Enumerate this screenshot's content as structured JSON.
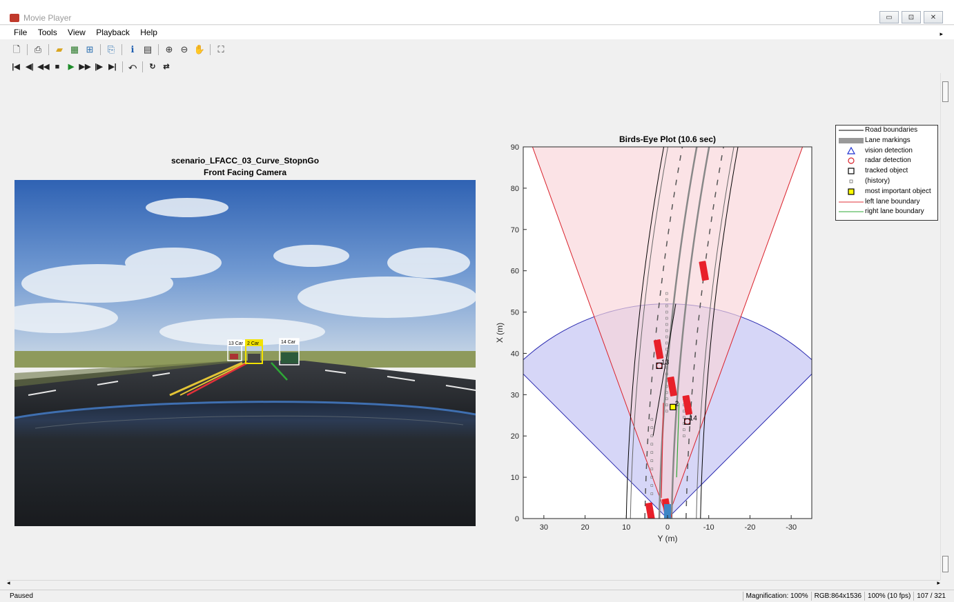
{
  "window": {
    "title": "Movie Player",
    "buttons": [
      "▭",
      "⊡",
      "✕"
    ]
  },
  "menu": [
    "File",
    "Tools",
    "View",
    "Playback",
    "Help"
  ],
  "toolbar": {
    "icons": [
      "new-icon",
      "print-icon",
      "open-icon",
      "open-workspace-icon",
      "simulink-icon",
      "export-icon",
      "info-icon",
      "colormap-icon",
      "zoom-in-icon",
      "zoom-out-icon",
      "pan-icon",
      "fit-window-icon"
    ],
    "playback": [
      "⏮",
      "◀|",
      "◀◀",
      "■",
      "▶",
      "▶▶",
      "|▶",
      "⏭"
    ]
  },
  "camera": {
    "title_line1": "scenario_LFACC_03_Curve_StopnGo",
    "title_line2": "Front Facing Camera",
    "boxes": [
      {
        "label": "13 Car",
        "highlight": false
      },
      {
        "label": "2 Car",
        "highlight": true
      },
      {
        "label": "14 Car",
        "highlight": false
      }
    ]
  },
  "bev": {
    "title": "Birds-Eye Plot (10.6 sec)",
    "xlabel": "Y (m)",
    "ylabel": "X (m)",
    "x_ticks": [
      "30",
      "20",
      "10",
      "0",
      "-10",
      "-20",
      "-30"
    ],
    "y_ticks": [
      "0",
      "10",
      "20",
      "30",
      "40",
      "50",
      "60",
      "70",
      "80",
      "90"
    ],
    "track_labels": [
      "13",
      "2",
      "14"
    ]
  },
  "chart_data": {
    "type": "scatter",
    "title": "Birds-Eye Plot (10.6 sec)",
    "xlabel": "Y (m)",
    "ylabel": "X (m)",
    "xlim": [
      35,
      -35
    ],
    "ylim": [
      0,
      90
    ],
    "tracked_objects": [
      {
        "id": "13",
        "y": 2,
        "x": 37
      },
      {
        "id": "2",
        "y": -1.3,
        "x": 27
      },
      {
        "id": "14",
        "y": -4.8,
        "x": 23.5
      }
    ],
    "vehicles": [
      {
        "y": -9,
        "x": 59
      },
      {
        "y": 2,
        "x": 40
      },
      {
        "y": -1.3,
        "x": 31
      },
      {
        "y": -5,
        "x": 26.5
      },
      {
        "y": 4,
        "x": 0.5
      },
      {
        "y": 0,
        "x": 1.5
      }
    ],
    "radar_coverage": {
      "range_m": 52,
      "fov_deg": 90
    },
    "vision_coverage": {
      "range_m": 90,
      "fov_deg": 40
    },
    "colors": {
      "radar_fill": "#ccccf5",
      "vision_fill": "#f9d4d8",
      "vehicle": "#e8202a",
      "ego": "#3d86c6",
      "important": "#ffff00",
      "left_lane": "#e0303a",
      "right_lane": "#2ea836"
    }
  },
  "legend": [
    {
      "label": "Road boundaries",
      "symbol": "black-line"
    },
    {
      "label": "Lane markings",
      "symbol": "gray-bar"
    },
    {
      "label": "vision detection",
      "symbol": "blue-triangle"
    },
    {
      "label": "radar detection",
      "symbol": "red-circle"
    },
    {
      "label": "tracked object",
      "symbol": "black-square"
    },
    {
      "label": "(history)",
      "symbol": "small-square"
    },
    {
      "label": "most important object",
      "symbol": "yellow-square"
    },
    {
      "label": "left lane boundary",
      "symbol": "red-line"
    },
    {
      "label": "right lane boundary",
      "symbol": "green-line"
    }
  ],
  "status": {
    "state": "Paused",
    "magnification": "Magnification: 100%",
    "rgb": "RGB:864x1536",
    "rate": "100% (10 fps)",
    "frame": "107 / 321"
  }
}
